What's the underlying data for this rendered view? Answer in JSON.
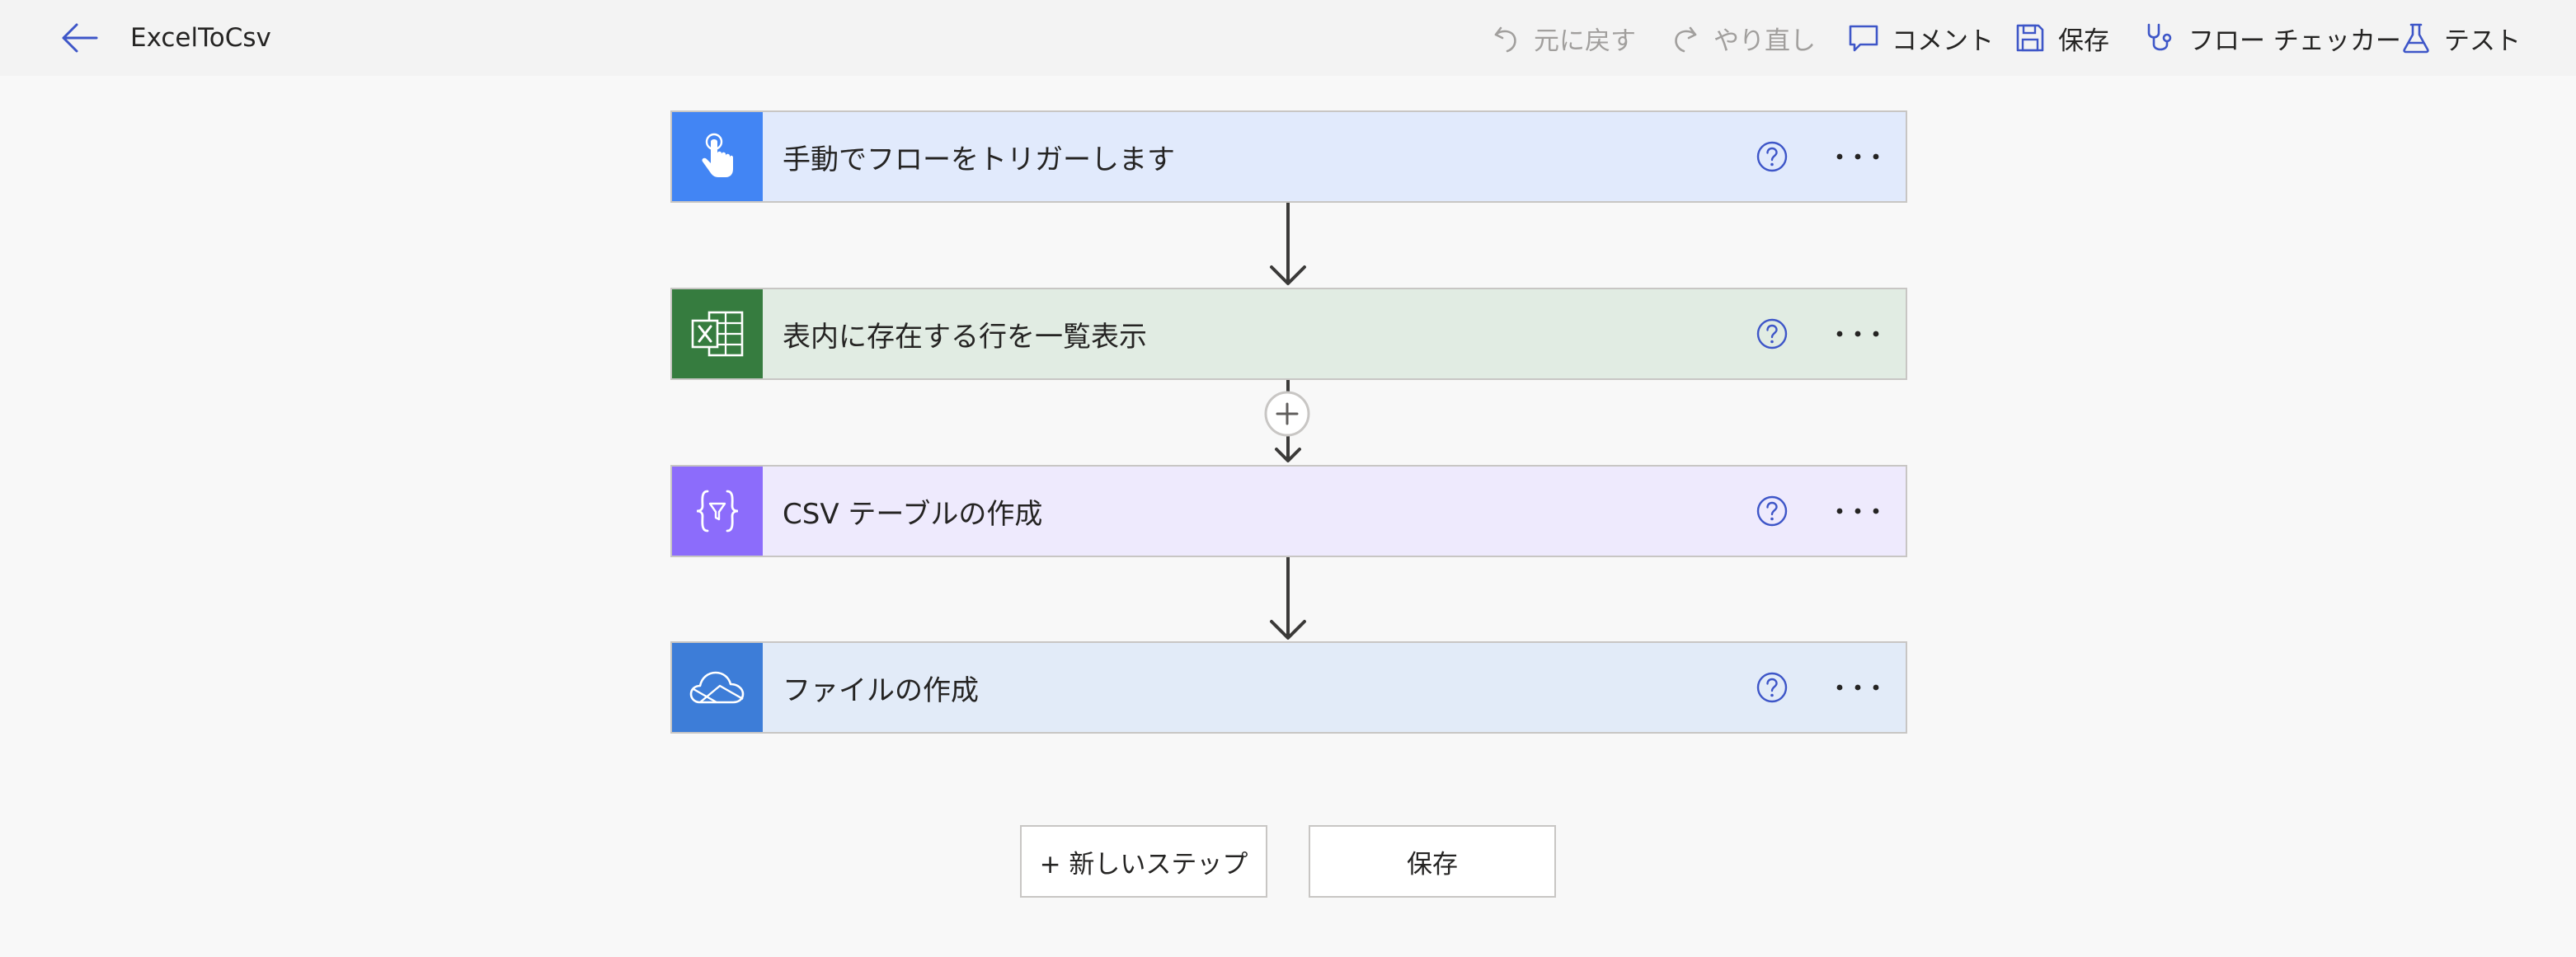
{
  "header": {
    "title": "ExcelToCsv",
    "back_icon": "arrow-left-icon"
  },
  "toolbar": {
    "undo": {
      "label": "元に戻す",
      "icon": "undo-icon",
      "enabled": false
    },
    "redo": {
      "label": "やり直し",
      "icon": "redo-icon",
      "enabled": false
    },
    "comment": {
      "label": "コメント",
      "icon": "comment-icon",
      "enabled": true
    },
    "save": {
      "label": "保存",
      "icon": "save-icon",
      "enabled": true
    },
    "flow_checker": {
      "label": "フロー チェッカー",
      "icon": "stethoscope-icon",
      "enabled": true
    },
    "test": {
      "label": "テスト",
      "icon": "flask-icon",
      "enabled": true
    }
  },
  "steps": [
    {
      "title": "手動でフローをトリガーします",
      "icon": "touch-trigger-icon",
      "color": "#4285f4",
      "bg": "#e1eafc"
    },
    {
      "title": "表内に存在する行を一覧表示",
      "icon": "excel-icon",
      "color": "#367c3f",
      "bg": "#e1ece3"
    },
    {
      "title": "CSV テーブルの作成",
      "icon": "data-operation-icon",
      "color": "#8c6cfb",
      "bg": "#eeeafd"
    },
    {
      "title": "ファイルの作成",
      "icon": "onedrive-icon",
      "color": "#3d7dd8",
      "bg": "#e2ebf8"
    }
  ],
  "actions": {
    "new_step": "+ 新しいステップ",
    "save": "保存"
  },
  "colors": {
    "accent": "#3e56c8",
    "disabled": "#a19f9d"
  }
}
